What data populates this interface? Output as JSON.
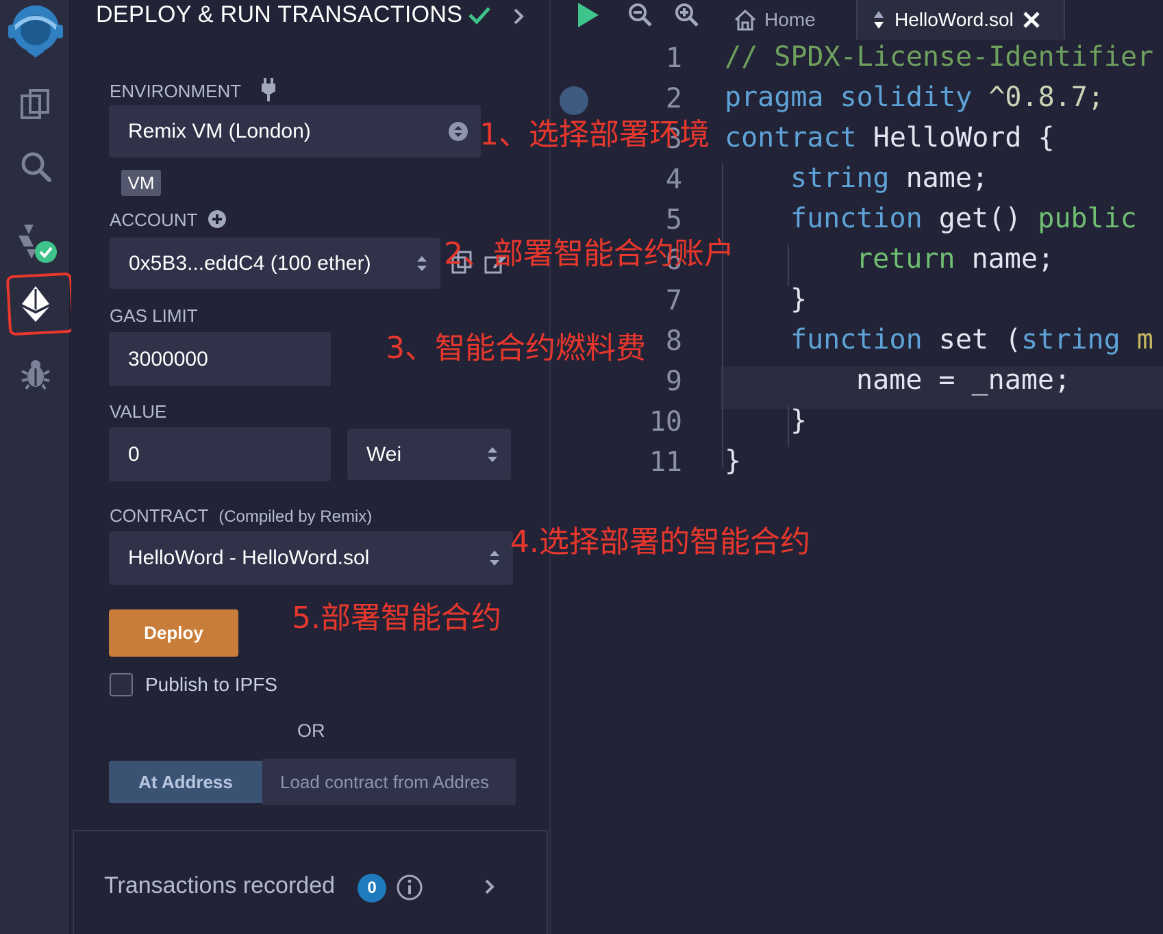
{
  "panel": {
    "title": "DEPLOY & RUN TRANSACTIONS",
    "environment_label": "ENVIRONMENT",
    "environment_value": "Remix VM (London)",
    "vm_badge": "VM",
    "account_label": "ACCOUNT",
    "account_value": "0x5B3...eddC4 (100 ether)",
    "gas_limit_label": "GAS LIMIT",
    "gas_limit_value": "3000000",
    "value_label": "VALUE",
    "value_amount": "0",
    "value_unit": "Wei",
    "contract_label": "CONTRACT",
    "contract_sublabel": "(Compiled by Remix)",
    "contract_value": "HelloWord - HelloWord.sol",
    "deploy_label": "Deploy",
    "publish_label": "Publish to IPFS",
    "or_label": "OR",
    "at_address_label": "At Address",
    "address_placeholder": "Load contract from Addres",
    "transactions_label": "Transactions recorded",
    "transactions_count": "0"
  },
  "editor": {
    "tabs": [
      {
        "label": "Home",
        "icon": "home-icon"
      },
      {
        "label": "HelloWord.sol",
        "icon": "file-sync-icon"
      }
    ],
    "line_numbers": [
      "1",
      "2",
      "3",
      "4",
      "5",
      "6",
      "7",
      "8",
      "9",
      "10",
      "11"
    ],
    "code": {
      "l1": "// SPDX-License-Identifier",
      "l2_kw": "pragma",
      "l2_kw2": "solidity",
      "l2_ver": "^0.8.7;",
      "l3_kw": "contract",
      "l3_rest": " HelloWord {",
      "l4_kw": "string",
      "l4_rest": " name;",
      "l5_kw": "function",
      "l5_rest": " get() ",
      "l5_mod": "public",
      "l6_kw": "return",
      "l6_rest": " name;",
      "l7": "}",
      "l8_kw": "function",
      "l8_rest": " set (",
      "l8_kw2": "string",
      "l8_tail": " m",
      "l9": "name = _name;",
      "l10": "}",
      "l11": "}"
    }
  },
  "annotations": {
    "a1": "1、选择部署环境",
    "a2": "2、部署智能合约账户",
    "a3": "3、智能合约燃料费",
    "a4": "4.选择部署的智能合约",
    "a5": "5.部署智能合约"
  },
  "colors": {
    "accent_deploy": "#c97d3a",
    "annotation_red": "#e8372c",
    "success_green": "#3ec48a",
    "badge_blue": "#1f7bbd"
  },
  "icons": [
    "remix-logo-icon",
    "file-explorer-icon",
    "search-icon",
    "compiler-icon",
    "deploy-icon",
    "debugger-icon",
    "plug-icon",
    "plus-circle-icon",
    "copy-icon",
    "edit-icon",
    "run-icon",
    "zoom-out-icon",
    "zoom-in-icon",
    "info-icon"
  ]
}
